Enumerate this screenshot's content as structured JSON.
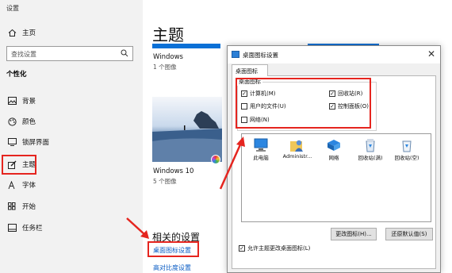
{
  "settings": {
    "window_title": "设置",
    "home": "主页",
    "search_placeholder": "查找设置",
    "section": "个性化",
    "nav": [
      {
        "label": "背景",
        "icon": "image-icon"
      },
      {
        "label": "颜色",
        "icon": "palette-icon"
      },
      {
        "label": "锁屏界面",
        "icon": "monitor-icon"
      },
      {
        "label": "主题",
        "icon": "brush-icon"
      },
      {
        "label": "字体",
        "icon": "font-icon"
      },
      {
        "label": "开始",
        "icon": "start-grid-icon"
      },
      {
        "label": "任务栏",
        "icon": "taskbar-icon"
      }
    ]
  },
  "main": {
    "title": "主题",
    "themes": [
      {
        "name": "Windows",
        "count": "1 个图像"
      },
      {
        "name": "Windows 10",
        "count": "5 个图像"
      }
    ],
    "related_heading": "相关的设置",
    "links": [
      "桌面图标设置",
      "高对比度设置"
    ]
  },
  "dialog": {
    "title": "桌面图标设置",
    "tab": "桌面图标",
    "group_label": "桌面图标",
    "checkboxes": [
      {
        "label": "计算机(M)",
        "checked": true
      },
      {
        "label": "回收站(R)",
        "checked": true
      },
      {
        "label": "用户的文件(U)",
        "checked": false
      },
      {
        "label": "控制面板(O)",
        "checked": true
      },
      {
        "label": "网络(N)",
        "checked": false
      }
    ],
    "icons": [
      "此电脑",
      "Administr...",
      "网络",
      "回收站(满)",
      "回收站(空)"
    ],
    "change_icon_button": "更改图标(H)...",
    "restore_default_button": "还原默认值(S)",
    "allow_themes": {
      "label": "允许主题更改桌面图标(L)",
      "checked": true
    }
  },
  "colors": {
    "accent": "#0a70d6",
    "highlight": "#e5251f"
  }
}
